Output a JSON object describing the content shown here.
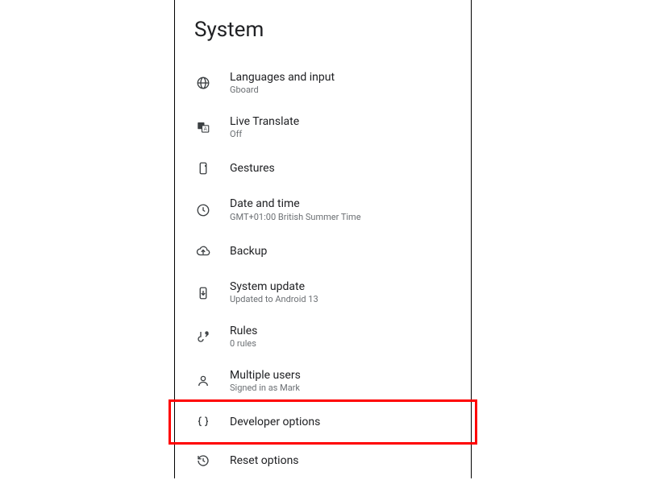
{
  "header": {
    "title": "System"
  },
  "items": [
    {
      "id": "languages",
      "icon": "globe-icon",
      "label": "Languages and input",
      "sub": "Gboard"
    },
    {
      "id": "live-translate",
      "icon": "translate-icon",
      "label": "Live Translate",
      "sub": "Off"
    },
    {
      "id": "gestures",
      "icon": "gestures-icon",
      "label": "Gestures",
      "sub": ""
    },
    {
      "id": "date-time",
      "icon": "clock-icon",
      "label": "Date and time",
      "sub": "GMT+01:00 British Summer Time"
    },
    {
      "id": "backup",
      "icon": "cloud-upload-icon",
      "label": "Backup",
      "sub": ""
    },
    {
      "id": "system-update",
      "icon": "system-update-icon",
      "label": "System update",
      "sub": "Updated to Android 13"
    },
    {
      "id": "rules",
      "icon": "rules-icon",
      "label": "Rules",
      "sub": "0 rules"
    },
    {
      "id": "multiple-users",
      "icon": "person-icon",
      "label": "Multiple users",
      "sub": "Signed in as Mark"
    },
    {
      "id": "developer-options",
      "icon": "braces-icon",
      "label": "Developer options",
      "sub": ""
    },
    {
      "id": "reset-options",
      "icon": "history-icon",
      "label": "Reset options",
      "sub": ""
    }
  ],
  "highlight": {
    "target": "developer-options"
  }
}
